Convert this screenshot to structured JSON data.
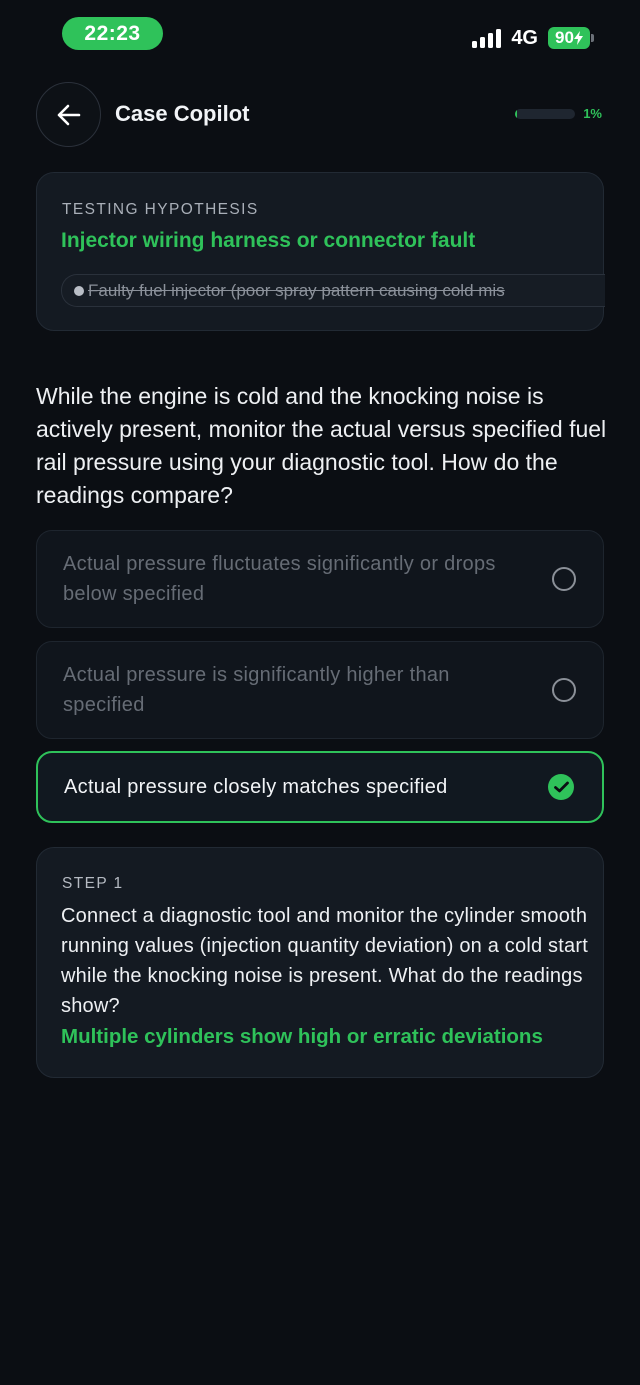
{
  "status_bar": {
    "time": "22:23",
    "network": "4G",
    "battery": "90"
  },
  "header": {
    "title": "Case Copilot",
    "progress_label": "1%",
    "progress_value": 0.01
  },
  "hypothesis": {
    "label": "TESTING HYPOTHESIS",
    "title": "Injector wiring harness or connector fault",
    "ruled_out": "Faulty fuel injector (poor spray pattern causing cold mis"
  },
  "question": "While the engine is cold and the knocking noise is actively present, monitor the actual versus specified fuel rail pressure using your diagnostic tool. How do the readings compare?",
  "options": [
    {
      "label": "Actual pressure fluctuates significantly or drops below specified",
      "selected": false
    },
    {
      "label": "Actual pressure is significantly higher than specified",
      "selected": false
    },
    {
      "label": "Actual pressure closely matches specified",
      "selected": true
    }
  ],
  "step": {
    "label": "STEP 1",
    "question": "Connect a diagnostic tool and monitor the cylinder smooth running values (injection quantity deviation) on a cold start while the knocking noise is present. What do the readings show?",
    "answer": "Multiple cylinders show high or erratic deviations"
  },
  "colors": {
    "accent": "#2fc25a",
    "background": "#0b0e13",
    "card": "#141a22"
  }
}
